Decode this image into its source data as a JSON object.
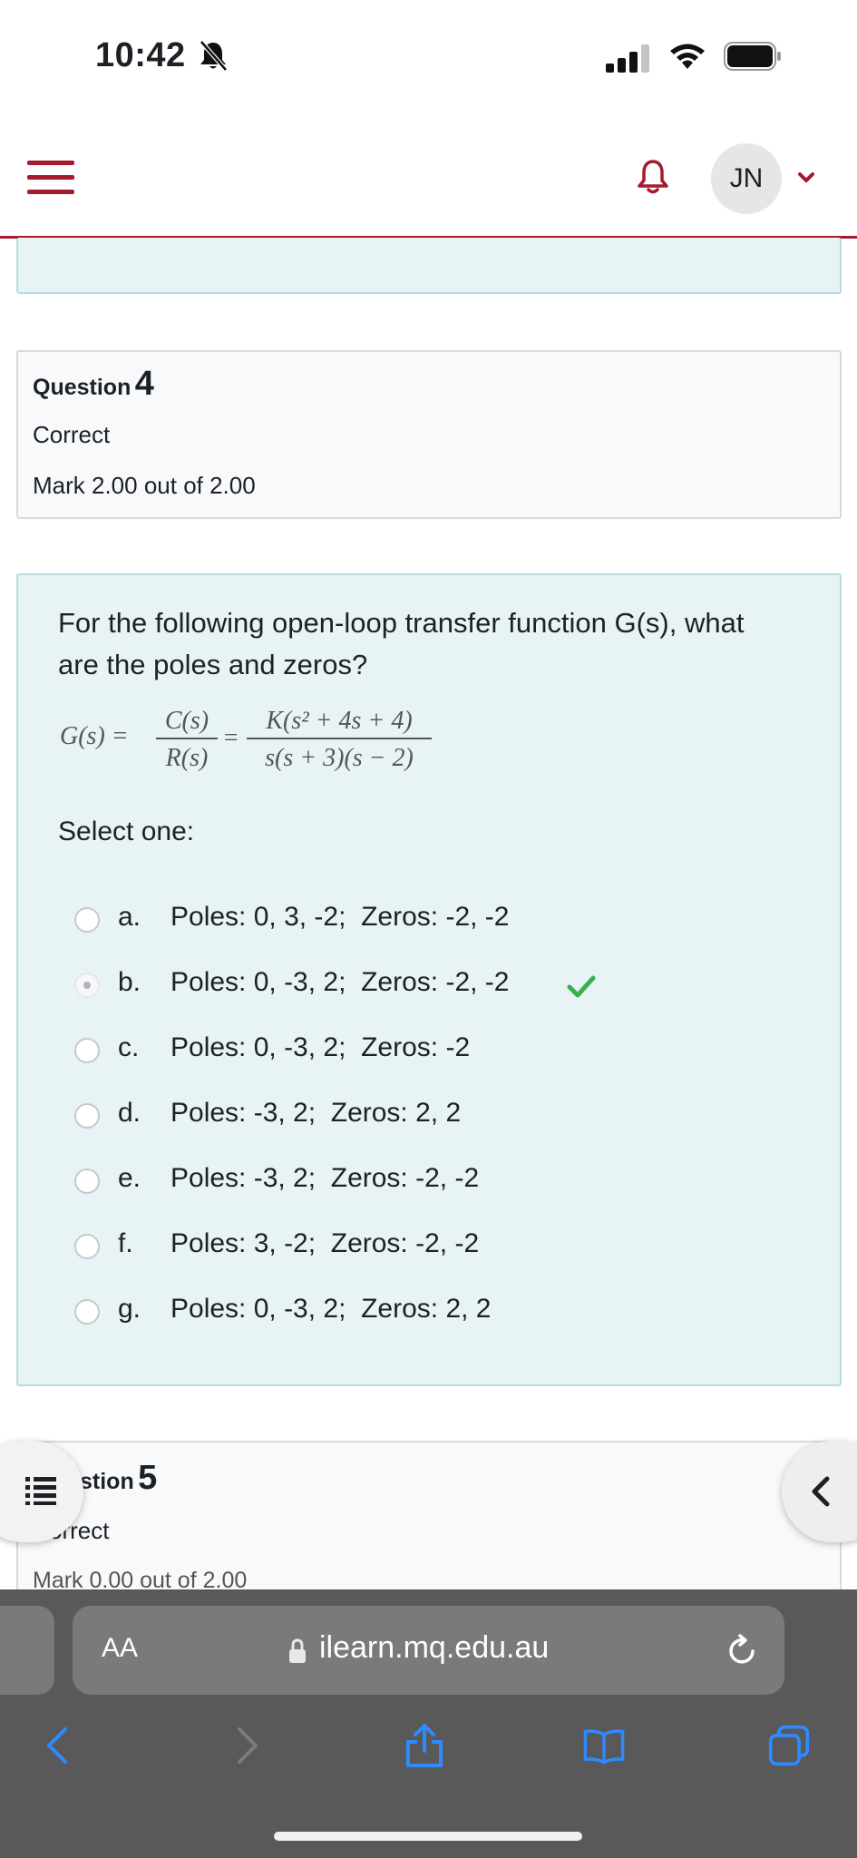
{
  "status_bar": {
    "time": "10:42"
  },
  "header": {
    "avatar_initials": "JN"
  },
  "question4": {
    "title_word": "Question",
    "number": "4",
    "state": "Correct",
    "grade": "Mark 2.00 out of 2.00",
    "text": "For the following open-loop transfer function G(s), what are the poles and zeros?",
    "equation": {
      "lhs": "G(s) =",
      "num1": "C(s)",
      "den1": "R(s)",
      "eq2": "=",
      "num2": "K(s² + 4s + 4)",
      "den2": "s(s + 3)(s − 2)"
    },
    "prompt": "Select one:",
    "options": [
      {
        "letter": "a.",
        "text": "Poles: 0, 3, -2;  Zeros: -2, -2",
        "selected": false,
        "correct": false
      },
      {
        "letter": "b.",
        "text": "Poles: 0, -3, 2;  Zeros: -2, -2",
        "selected": true,
        "correct": true
      },
      {
        "letter": "c.",
        "text": "Poles: 0, -3, 2;  Zeros: -2",
        "selected": false,
        "correct": false
      },
      {
        "letter": "d.",
        "text": "Poles: -3, 2;  Zeros: 2, 2",
        "selected": false,
        "correct": false
      },
      {
        "letter": "e.",
        "text": "Poles: -3, 2;  Zeros: -2, -2",
        "selected": false,
        "correct": false
      },
      {
        "letter": "f.",
        "text": "Poles: 3, -2;  Zeros: -2, -2",
        "selected": false,
        "correct": false
      },
      {
        "letter": "g.",
        "text": "Poles: 0, -3, 2;  Zeros: 2, 2",
        "selected": false,
        "correct": false
      }
    ]
  },
  "question5": {
    "title_word": "stion",
    "number": "5",
    "state": "orrect",
    "grade": "Mark 0.00 out of 2.00"
  },
  "browser": {
    "aa_label": "AA",
    "url": "ilearn.mq.edu.au"
  },
  "colors": {
    "brand": "#a6192e",
    "correct_check": "#3bae4f",
    "info_bg": "#f8f9fa",
    "formulation_bg": "#e7f3f5"
  },
  "icons": [
    "bell-slash-icon",
    "signal-icon",
    "wifi-icon",
    "battery-icon",
    "hamburger-icon",
    "bell-icon",
    "chevron-down-icon",
    "check-icon",
    "list-icon",
    "chevron-left-icon",
    "lock-icon",
    "reload-icon",
    "back-icon",
    "forward-icon",
    "share-icon",
    "bookmarks-icon",
    "tabs-icon"
  ]
}
